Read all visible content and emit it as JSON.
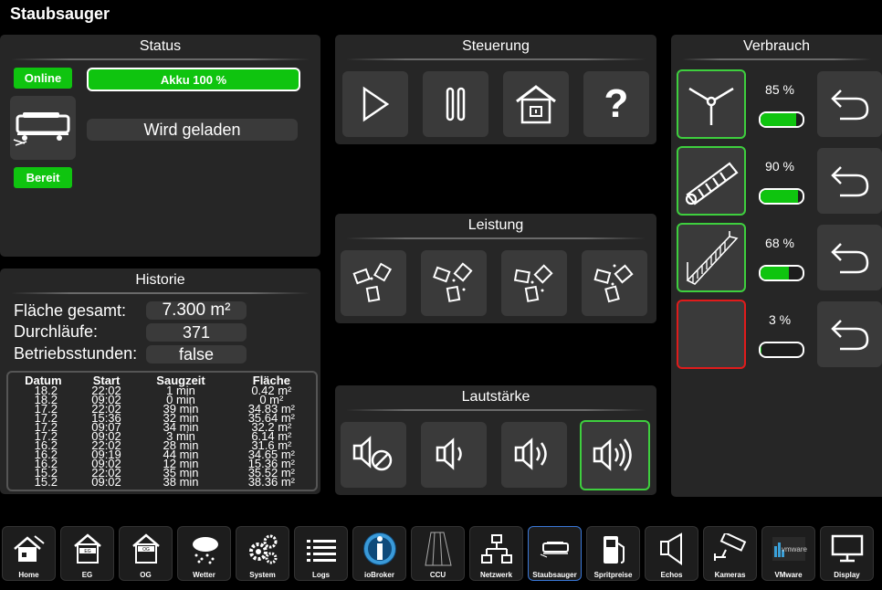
{
  "page": {
    "title": "Staubsauger"
  },
  "status": {
    "title": "Status",
    "online": "Online",
    "battery": "Akku 100 %",
    "state": "Wird geladen",
    "ready": "Bereit"
  },
  "control": {
    "title": "Steuerung",
    "buttons": [
      {
        "icon": "play-icon"
      },
      {
        "icon": "pause-icon"
      },
      {
        "icon": "home-dock-icon"
      },
      {
        "icon": "question-icon",
        "label": "?"
      }
    ]
  },
  "power": {
    "title": "Leistung",
    "buttons": [
      {
        "icon": "fan-level-1-icon"
      },
      {
        "icon": "fan-level-2-icon"
      },
      {
        "icon": "fan-level-3-icon"
      },
      {
        "icon": "fan-level-4-icon"
      }
    ]
  },
  "volume": {
    "title": "Lautstärke",
    "buttons": [
      {
        "icon": "speaker-mute-icon"
      },
      {
        "icon": "speaker-low-icon"
      },
      {
        "icon": "speaker-medium-icon"
      },
      {
        "icon": "speaker-high-icon",
        "active": true
      }
    ]
  },
  "consumption": {
    "title": "Verbrauch",
    "items": [
      {
        "icon": "side-brush-icon",
        "percent_label": "85 %",
        "percent": 85,
        "status": "ok"
      },
      {
        "icon": "main-brush-icon",
        "percent_label": "90 %",
        "percent": 90,
        "status": "ok"
      },
      {
        "icon": "filter-icon",
        "percent_label": "68 %",
        "percent": 68,
        "status": "ok"
      },
      {
        "icon": "sensor-icon",
        "percent_label": "3 %",
        "percent": 3,
        "status": "warning"
      }
    ],
    "accent_ok": "#3ecf3e",
    "accent_warn": "#e01b1b"
  },
  "history": {
    "title": "Historie",
    "area_label": "Fläche gesamt:",
    "area_value": "7.300 m²",
    "runs_label": "Durchläufe:",
    "runs_value": "371",
    "hours_label": "Betriebsstunden:",
    "hours_value": "false",
    "columns": [
      "Datum",
      "Start",
      "Saugzeit",
      "Fläche"
    ],
    "rows": [
      [
        "18.2",
        "22:02",
        "1 min",
        "0.42 m²"
      ],
      [
        "18.2",
        "09:02",
        "0 min",
        "0 m²"
      ],
      [
        "17.2",
        "22:02",
        "39 min",
        "34.83 m²"
      ],
      [
        "17.2",
        "15:36",
        "32 min",
        "35.64 m²"
      ],
      [
        "17.2",
        "09:07",
        "34 min",
        "32.2 m²"
      ],
      [
        "17.2",
        "09:02",
        "3 min",
        "6.14 m²"
      ],
      [
        "16.2",
        "22:02",
        "28 min",
        "31.6 m²"
      ],
      [
        "16.2",
        "09:19",
        "44 min",
        "34.65 m²"
      ],
      [
        "16.2",
        "09:02",
        "12 min",
        "15.36 m²"
      ],
      [
        "15.2",
        "22:02",
        "35 min",
        "35.52 m²"
      ],
      [
        "15.2",
        "09:02",
        "38 min",
        "38.36 m²"
      ]
    ]
  },
  "navbar": [
    {
      "label": "Home",
      "icon": "home-icon"
    },
    {
      "label": "EG",
      "icon": "ground-floor-icon",
      "badge": "EG"
    },
    {
      "label": "OG",
      "icon": "upper-floor-icon",
      "badge": "OG"
    },
    {
      "label": "Wetter",
      "icon": "weather-icon"
    },
    {
      "label": "System",
      "icon": "gears-icon"
    },
    {
      "label": "Logs",
      "icon": "list-icon"
    },
    {
      "label": "ioBroker",
      "icon": "iobroker-icon"
    },
    {
      "label": "CCU",
      "icon": "ccu-icon"
    },
    {
      "label": "Netzwerk",
      "icon": "network-icon"
    },
    {
      "label": "Staubsauger",
      "icon": "vacuum-icon",
      "active": true
    },
    {
      "label": "Spritpreise",
      "icon": "fuel-icon"
    },
    {
      "label": "Echos",
      "icon": "speaker-icon"
    },
    {
      "label": "Kameras",
      "icon": "camera-icon"
    },
    {
      "label": "VMware",
      "icon": "vmware-icon",
      "badge": "vmware"
    },
    {
      "label": "Display",
      "icon": "monitor-icon"
    }
  ]
}
